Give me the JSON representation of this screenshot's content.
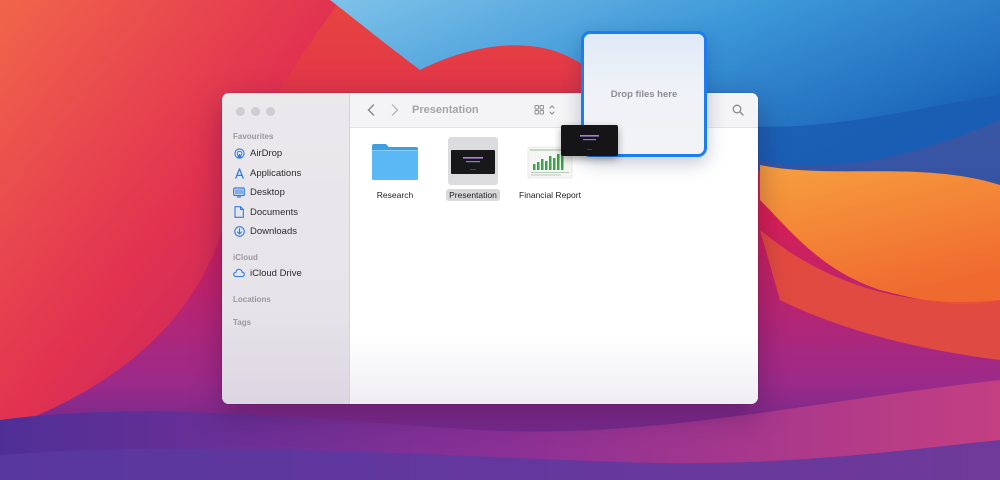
{
  "finder": {
    "title": "Presentation",
    "sidebar": {
      "sections": {
        "favourites": "Favourites",
        "icloud": "iCloud",
        "locations": "Locations",
        "tags": "Tags"
      },
      "favourites": [
        {
          "label": "AirDrop",
          "icon": "airdrop-icon"
        },
        {
          "label": "Applications",
          "icon": "applications-icon"
        },
        {
          "label": "Desktop",
          "icon": "desktop-icon"
        },
        {
          "label": "Documents",
          "icon": "document-icon"
        },
        {
          "label": "Downloads",
          "icon": "downloads-icon"
        }
      ],
      "icloud": [
        {
          "label": "iCloud Drive",
          "icon": "cloud-icon"
        }
      ]
    },
    "files": [
      {
        "name": "Research",
        "icon": "folder-icon",
        "selected": false
      },
      {
        "name": "Presentation",
        "icon": "presentation-thumbnail",
        "selected": true
      },
      {
        "name": "Financial Report",
        "icon": "spreadsheet-thumbnail",
        "selected": false
      }
    ]
  },
  "dropzone": {
    "text": "Drop files here"
  },
  "colors": {
    "accent": "#1a7df0",
    "sidebar_icon": "#2f7de1",
    "folder": "#5ab8f5"
  }
}
